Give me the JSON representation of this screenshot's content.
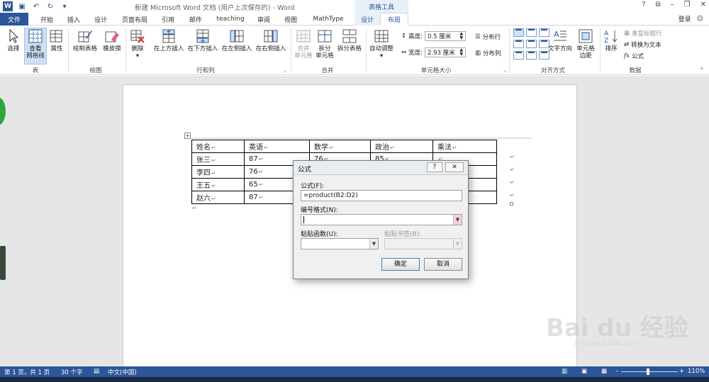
{
  "app": {
    "title": "新建 Microsoft Word 文档 (用户上次保存的) - Word",
    "context_tools_label": "表格工具",
    "sign_in": "登录"
  },
  "tabs": [
    {
      "label": "文件",
      "kind": "file"
    },
    {
      "label": "开始"
    },
    {
      "label": "插入"
    },
    {
      "label": "设计"
    },
    {
      "label": "页面布局"
    },
    {
      "label": "引用"
    },
    {
      "label": "邮件"
    },
    {
      "label": "teaching"
    },
    {
      "label": "审阅"
    },
    {
      "label": "视图"
    },
    {
      "label": "MathType"
    },
    {
      "label": "设计",
      "kind": "ctx"
    },
    {
      "label": "布局",
      "kind": "active"
    }
  ],
  "ribbon": {
    "table_group": {
      "select": "选择",
      "gridlines": "查看\n网格线",
      "properties": "属性",
      "label": "表"
    },
    "draw_group": {
      "draw_table": "绘制表格",
      "eraser": "橡皮擦",
      "label": "绘图"
    },
    "delete_label": "删除",
    "rows_cols": {
      "insert_above": "在上方插入",
      "insert_below": "在下方插入",
      "insert_left": "在左侧插入",
      "insert_right": "在右侧插入",
      "label": "行和列"
    },
    "merge": {
      "merge_cells": "合并\n单元格",
      "split_cells": "拆分\n单元格",
      "split_table": "拆分表格",
      "label": "合并"
    },
    "cell_size": {
      "autofit": "自动调整",
      "height_label": "高度:",
      "height_value": "0.5 厘米",
      "width_label": "宽度:",
      "width_value": "2.93 厘米",
      "distribute_rows": "分布行",
      "distribute_cols": "分布列",
      "label": "单元格大小"
    },
    "alignment": {
      "text_direction": "文字方向",
      "cell_margins": "单元格\n边距",
      "label": "对齐方式"
    },
    "data": {
      "sort": "排序",
      "repeat_header": "重复标题行",
      "convert_to_text": "转换为文本",
      "formula": "公式",
      "label": "数据"
    }
  },
  "table": {
    "headers": [
      "姓名",
      "英语",
      "数学",
      "政治",
      "乘法"
    ],
    "rows": [
      [
        "张三",
        "87",
        "76",
        "85",
        ""
      ],
      [
        "李四",
        "76",
        "",
        "",
        ""
      ],
      [
        "王五",
        "65",
        "",
        "",
        ""
      ],
      [
        "赵六",
        "87",
        "",
        "",
        ""
      ]
    ]
  },
  "dialog": {
    "title": "公式",
    "help": "?",
    "close": "✕",
    "formula_label": "公式(F):",
    "formula_value": "=product(B2:D2)",
    "number_format_label": "编号格式(N):",
    "number_format_value": "",
    "paste_function_label": "粘贴函数(U):",
    "paste_bookmark_label": "粘贴书签(B):",
    "ok": "确定",
    "cancel": "取消"
  },
  "status": {
    "page": "第 1 页，共 1 页",
    "words": "30 个字",
    "language": "中文(中国)",
    "zoom": "110%"
  },
  "watermark": {
    "brand": "Bai du 经验",
    "url": "jingyan.baidu.com"
  }
}
